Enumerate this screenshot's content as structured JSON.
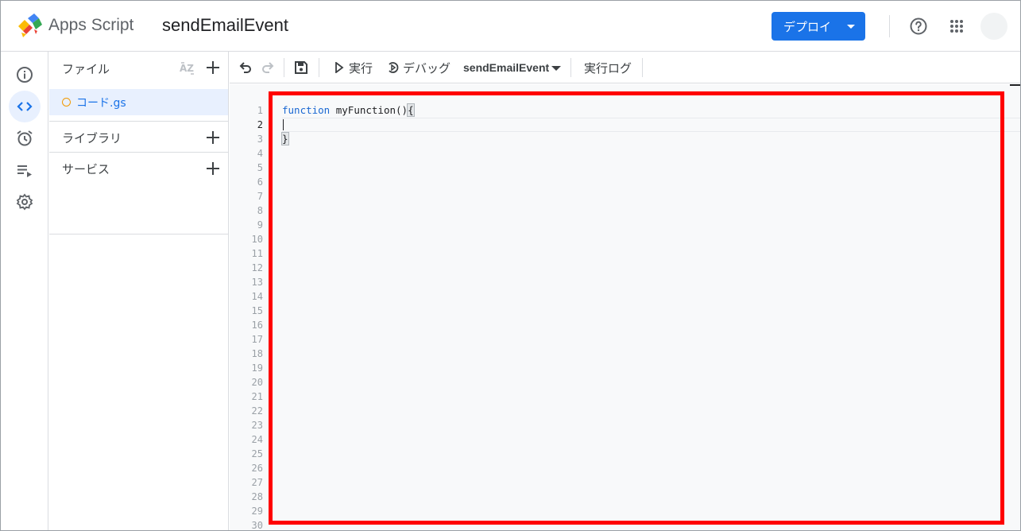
{
  "header": {
    "app_name": "Apps Script",
    "project_name": "sendEmailEvent",
    "deploy_label": "デプロイ"
  },
  "rail": {
    "items": [
      "overview-icon",
      "editor-icon",
      "triggers-icon",
      "executions-icon",
      "settings-icon"
    ],
    "active": "editor-icon"
  },
  "files_panel": {
    "title": "ファイル",
    "files": [
      {
        "name": "コード.gs",
        "status_color": "#f29900"
      }
    ],
    "sections": [
      {
        "label": "ライブラリ"
      },
      {
        "label": "サービス"
      }
    ]
  },
  "toolbar": {
    "run_label": "実行",
    "debug_label": "デバッグ",
    "function_select": "sendEmailEvent",
    "log_label": "実行ログ"
  },
  "editor": {
    "code_lines": [
      {
        "keyword": "function",
        "rest": " myFunction()",
        "brace": "{"
      },
      {
        "keyword": "",
        "rest": "",
        "brace": ""
      },
      {
        "keyword": "",
        "rest": "",
        "brace": "}"
      }
    ],
    "line_numbers": [
      "1",
      "2",
      "3",
      "4",
      "5",
      "6",
      "7",
      "8",
      "9",
      "10",
      "11",
      "12",
      "13",
      "14",
      "15",
      "16",
      "17",
      "18",
      "19",
      "20",
      "21",
      "22",
      "23",
      "24",
      "25",
      "26",
      "27",
      "28",
      "29",
      "30"
    ],
    "current_line": "2"
  },
  "colors": {
    "accent": "#1a73e8",
    "highlight_border": "#ff0000"
  }
}
